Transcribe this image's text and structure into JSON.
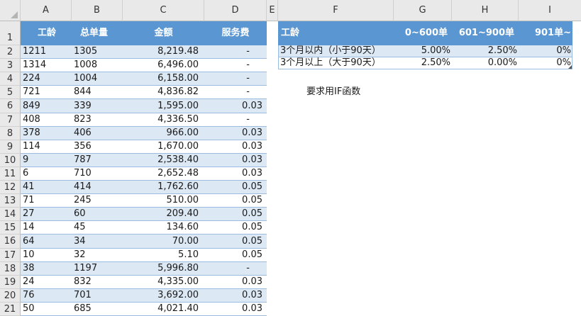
{
  "column_headers": [
    "A",
    "B",
    "C",
    "D",
    "E",
    "F",
    "G",
    "H",
    "I"
  ],
  "left_table": {
    "headers": [
      "工龄",
      "总单量",
      "金额",
      "服务费"
    ],
    "rows": [
      {
        "r": "2",
        "a": "1211",
        "b": "1305",
        "c": "8,219.48",
        "d": "-"
      },
      {
        "r": "3",
        "a": "1314",
        "b": "1008",
        "c": "6,496.00",
        "d": "-"
      },
      {
        "r": "4",
        "a": "224",
        "b": "1004",
        "c": "6,158.00",
        "d": "-"
      },
      {
        "r": "5",
        "a": "721",
        "b": "844",
        "c": "4,836.82",
        "d": "-"
      },
      {
        "r": "6",
        "a": "849",
        "b": "339",
        "c": "1,595.00",
        "d": "0.03"
      },
      {
        "r": "7",
        "a": "408",
        "b": "823",
        "c": "4,336.50",
        "d": "-"
      },
      {
        "r": "8",
        "a": "378",
        "b": "406",
        "c": "966.00",
        "d": "0.03"
      },
      {
        "r": "9",
        "a": "114",
        "b": "356",
        "c": "1,670.00",
        "d": "0.03"
      },
      {
        "r": "10",
        "a": "9",
        "b": "787",
        "c": "2,538.40",
        "d": "0.03"
      },
      {
        "r": "11",
        "a": "6",
        "b": "710",
        "c": "2,652.48",
        "d": "0.03"
      },
      {
        "r": "12",
        "a": "41",
        "b": "414",
        "c": "1,762.60",
        "d": "0.05"
      },
      {
        "r": "13",
        "a": "71",
        "b": "245",
        "c": "510.00",
        "d": "0.05"
      },
      {
        "r": "14",
        "a": "27",
        "b": "60",
        "c": "209.40",
        "d": "0.05"
      },
      {
        "r": "15",
        "a": "14",
        "b": "45",
        "c": "134.60",
        "d": "0.05"
      },
      {
        "r": "16",
        "a": "64",
        "b": "34",
        "c": "70.00",
        "d": "0.05"
      },
      {
        "r": "17",
        "a": "10",
        "b": "32",
        "c": "5.10",
        "d": "0.05"
      },
      {
        "r": "18",
        "a": "38",
        "b": "1197",
        "c": "5,996.80",
        "d": "-"
      },
      {
        "r": "19",
        "a": "24",
        "b": "832",
        "c": "4,335.00",
        "d": "0.03"
      },
      {
        "r": "20",
        "a": "76",
        "b": "701",
        "c": "3,692.00",
        "d": "0.03"
      },
      {
        "r": "21",
        "a": "50",
        "b": "685",
        "c": "4,021.40",
        "d": "0.03"
      }
    ]
  },
  "right_table": {
    "headers": [
      "工龄",
      "0~600单",
      "601~900单",
      "901单~"
    ],
    "rows": [
      {
        "f": "3个月以内（小于90天）",
        "g": "5.00%",
        "h": "2.50%",
        "i": "0%"
      },
      {
        "f": "3个月以上（大于90天）",
        "g": "2.50%",
        "h": "0.00%",
        "i": "0%"
      }
    ]
  },
  "row1_label": "1",
  "note": "要求用IF函数",
  "colors": {
    "header_blue": "#5a96d2",
    "band_blue": "#dde8f5",
    "grid_gray": "#e9e9e9"
  }
}
